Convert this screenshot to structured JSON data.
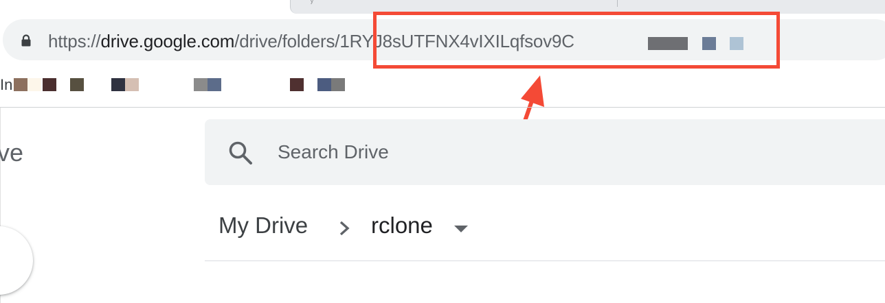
{
  "tab": {
    "icon": "tab-favicon-fragment",
    "glyph": "ʸ"
  },
  "omnibox": {
    "icon": "lock-icon",
    "url_scheme": "https://",
    "url_host": "drive.google.com",
    "url_path": "/drive/folders/1RYJ8sUTFNX4vIXILqfsov9C",
    "redacted_colors": [
      "#6e6f73",
      "#6b7c97",
      "#aec3d5"
    ]
  },
  "bookmarks": {
    "prefix": "In",
    "swatch_colors": [
      "#8d705e",
      "#fdf6ea",
      "#4b2f2f",
      "#575040",
      "#2f3240",
      "#d5bfb3",
      "#8b8b8b",
      "#5c6c8a",
      "#4f3030",
      "#4c5c80",
      "#7a7a7a"
    ]
  },
  "annotation": {
    "color": "#f44a36"
  },
  "sidebar": {
    "logo_fragment": "ve",
    "new_button_icon": "new-button"
  },
  "search": {
    "icon": "search-icon",
    "placeholder": "Search Drive",
    "value": ""
  },
  "breadcrumb": {
    "root": "My Drive",
    "separator_icon": "chevron-right-icon",
    "current": "rclone",
    "dropdown_icon": "caret-down-icon"
  },
  "colors": {
    "omnibox_bg": "#f1f3f4",
    "search_bg": "#f1f3f4",
    "text_primary": "#202124",
    "text_secondary": "#5f6368"
  }
}
